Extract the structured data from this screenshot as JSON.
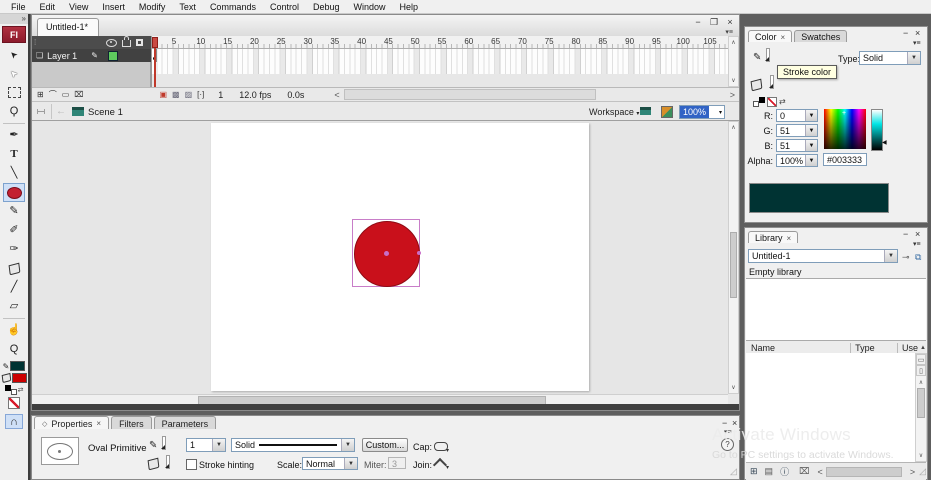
{
  "menu": {
    "items": [
      "File",
      "Edit",
      "View",
      "Insert",
      "Modify",
      "Text",
      "Commands",
      "Control",
      "Debug",
      "Window",
      "Help"
    ]
  },
  "doc": {
    "tab": "Untitled-1*"
  },
  "icons": {
    "close": "×",
    "minimize": "−",
    "restore": "❐",
    "panel_menu": "▾≡",
    "dropdown_arrow": "▾",
    "combo_arrow": "▼",
    "scroll_up": "∧",
    "scroll_down": "∨",
    "scroll_left": "<",
    "scroll_right": ">",
    "collapse": "»",
    "sort_asc": "▲",
    "help": "?",
    "back_arrow": "←",
    "tab_diamond": "◇",
    "grip": "◿",
    "wide_view": "▭",
    "narrow_view": "▯",
    "new_symbol": "⊞",
    "new_folder": "▤",
    "item_properties": "ⓘ",
    "delete_item": "⌧",
    "pin_library": "⊸",
    "new_library_panel": "⧉",
    "insert_layer": "⊞",
    "motion_guide": "⌒",
    "layer_folder": "▭",
    "delete_layer": "⌧",
    "center_frame": "▣",
    "onion_skin": "▩",
    "onion_outline": "▨",
    "edit_multiple": "[·]",
    "layer_page": "❏",
    "pencil": "✎",
    "swap": "⇄",
    "magnet": "∩",
    "drag_dots": "⁞"
  },
  "toolbar": {
    "collapse": "»",
    "logo": "Fl",
    "stroke_color": "#003333",
    "fill_color": "#cc0000",
    "tools": [
      {
        "name": "selection-tool",
        "kind": "glyph",
        "glyph": "➤",
        "cls": "nw"
      },
      {
        "name": "subselection-tool",
        "kind": "glyph",
        "glyph": "➤",
        "cls": "nw hollow"
      },
      {
        "name": "free-transform-tool",
        "kind": "marquee"
      },
      {
        "name": "lasso-tool",
        "kind": "glyph",
        "glyph": "Ϙ"
      },
      {
        "name": "divider",
        "kind": "divider"
      },
      {
        "name": "pen-tool",
        "kind": "glyph",
        "glyph": "✒"
      },
      {
        "name": "text-tool",
        "kind": "glyph",
        "glyph": "T",
        "cls": "bold"
      },
      {
        "name": "line-tool",
        "kind": "glyph",
        "glyph": "╲"
      },
      {
        "name": "oval-tool",
        "kind": "oval",
        "selected": true
      },
      {
        "name": "pencil-tool",
        "kind": "glyph",
        "glyph": "✎"
      },
      {
        "name": "brush-tool",
        "kind": "glyph",
        "glyph": "✐"
      },
      {
        "name": "ink-bottle-tool",
        "kind": "glyph",
        "glyph": "✑"
      },
      {
        "name": "paint-bucket-tool",
        "kind": "bucket"
      },
      {
        "name": "eyedropper-tool",
        "kind": "glyph",
        "glyph": "╱"
      },
      {
        "name": "eraser-tool",
        "kind": "glyph",
        "glyph": "▱"
      },
      {
        "name": "divider",
        "kind": "divider"
      },
      {
        "name": "hand-tool",
        "kind": "glyph",
        "glyph": "☝"
      },
      {
        "name": "zoom-tool",
        "kind": "glyph",
        "glyph": "Q"
      }
    ]
  },
  "timeline": {
    "layer_name": "Layer 1",
    "ruler_ticks": [
      5,
      10,
      15,
      20,
      25,
      30,
      35,
      40,
      45,
      50,
      55,
      60,
      65,
      70,
      75,
      80,
      85,
      90,
      95,
      100,
      105
    ],
    "status": {
      "current_frame": "1",
      "frame_rate": "12.0 fps",
      "elapsed_time": "0.0s"
    }
  },
  "edit_bar": {
    "scene_name": "Scene 1",
    "workspace_label": "Workspace",
    "zoom_value": "100%"
  },
  "stage": {
    "fill_color": "#c9101b"
  },
  "properties": {
    "tabs": {
      "properties": "Properties",
      "filters": "Filters",
      "parameters": "Parameters"
    },
    "object_type": "Oval Primitive",
    "stroke_weight": "1",
    "stroke_style": "Solid",
    "custom_button": "Custom...",
    "cap_label": "Cap:",
    "stroke_hinting": "Stroke hinting",
    "scale_label": "Scale:",
    "scale_value": "Normal",
    "miter_label": "Miter:",
    "miter_value": "3",
    "join_label": "Join:"
  },
  "color_panel": {
    "tab_color": "Color",
    "tab_swatches": "Swatches",
    "type_label": "Type:",
    "type_value": "Solid",
    "tooltip": "Stroke color",
    "r_label": "R:",
    "r_value": "0",
    "g_label": "G:",
    "g_value": "51",
    "b_label": "B:",
    "b_value": "51",
    "alpha_label": "Alpha:",
    "alpha_value": "100%",
    "hex_value": "#003333",
    "stroke_color": "#003333",
    "fill_color": "#cc0000",
    "preview_color": "#003333"
  },
  "library": {
    "tab": "Library",
    "document_name": "Untitled-1",
    "empty_text": "Empty library",
    "col_name": "Name",
    "col_type": "Type",
    "col_use": "Use"
  },
  "watermark": {
    "title": "Activate Windows",
    "subtitle": "Go to PC settings to activate Windows."
  }
}
